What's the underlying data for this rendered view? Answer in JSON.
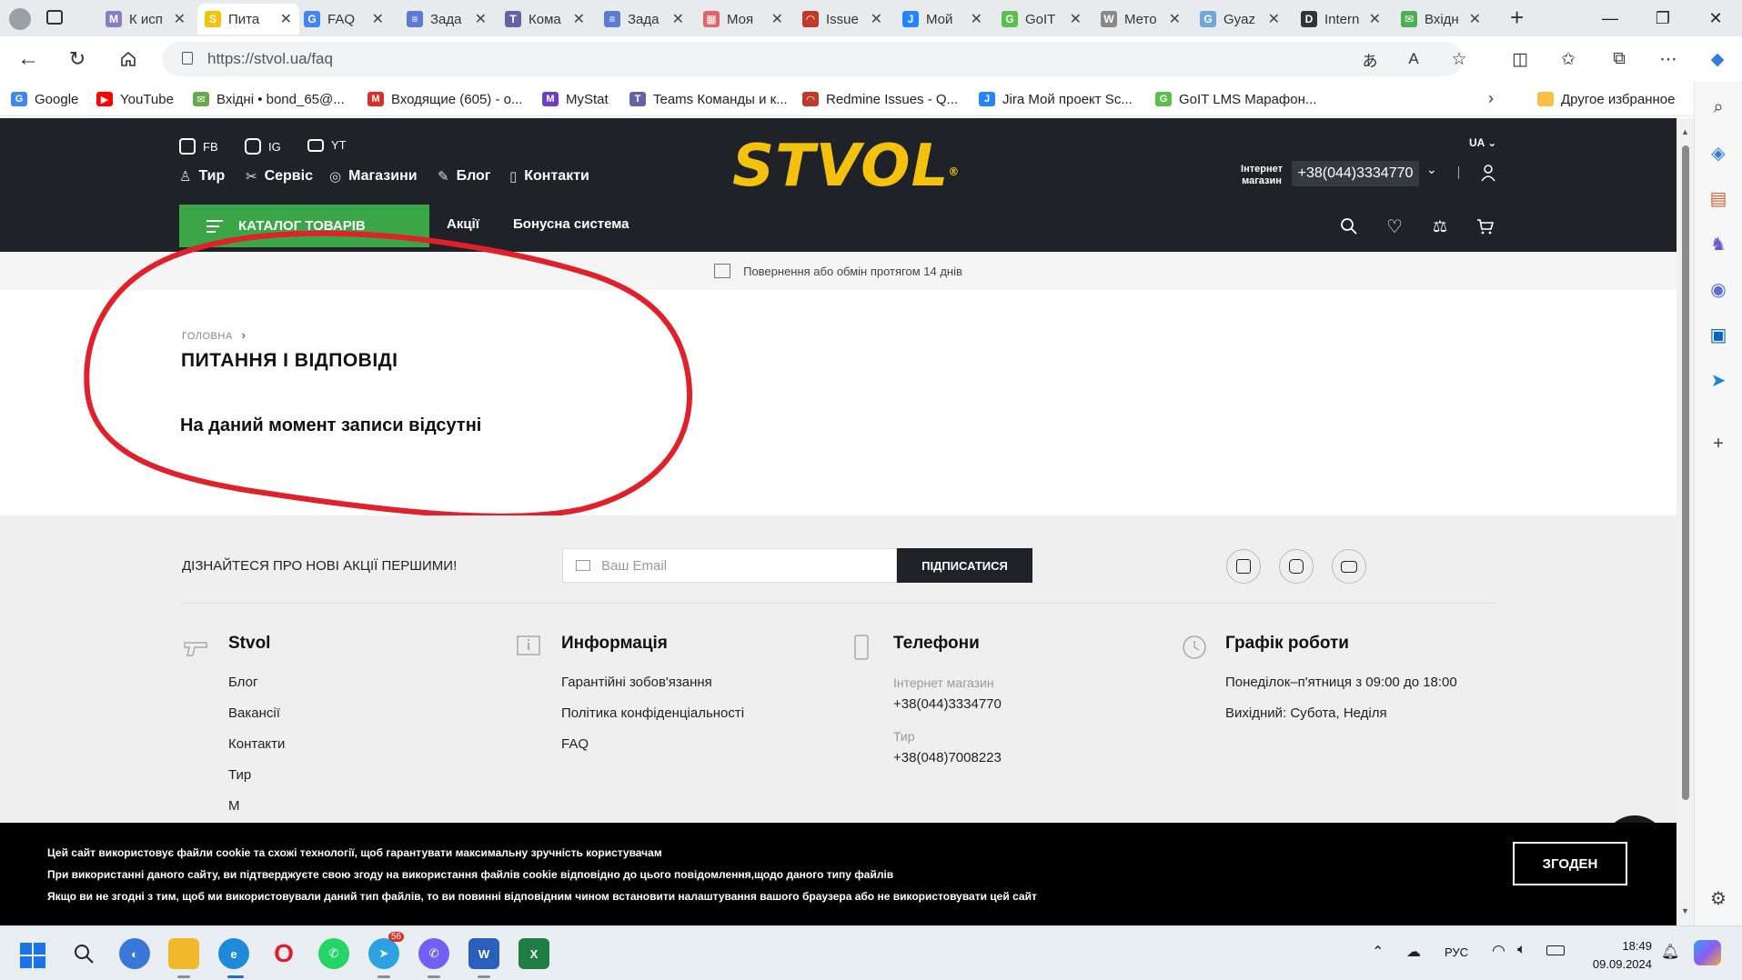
{
  "browser": {
    "tabs": [
      {
        "title": "К исп",
        "color": "#8e7cc3",
        "glyph": "M"
      },
      {
        "title": "Пита",
        "color": "#f4c20d",
        "glyph": "S"
      },
      {
        "title": "FAQ",
        "color": "#4285f4",
        "glyph": "G"
      },
      {
        "title": "Зада",
        "color": "#5b7bd5",
        "glyph": "≡"
      },
      {
        "title": "Кома",
        "color": "#6264a7",
        "glyph": "T"
      },
      {
        "title": "Зада",
        "color": "#5b7bd5",
        "glyph": "≡"
      },
      {
        "title": "Моя",
        "color": "#e06666",
        "glyph": "▦"
      },
      {
        "title": "Issue",
        "color": "#c0392b",
        "glyph": "◠"
      },
      {
        "title": "Мой",
        "color": "#2684ff",
        "glyph": "J"
      },
      {
        "title": "GoIT",
        "color": "#5bbf4a",
        "glyph": "G"
      },
      {
        "title": "Мето",
        "color": "#888888",
        "glyph": "W"
      },
      {
        "title": "Gyaz",
        "color": "#6fa8dc",
        "glyph": "G"
      },
      {
        "title": "Intern",
        "color": "#333333",
        "glyph": "D"
      },
      {
        "title": "Вхідн",
        "color": "#4caf50",
        "glyph": "✉"
      }
    ],
    "url": "https://stvol.ua/faq",
    "favorites": [
      {
        "label": "Google",
        "color": "#4285f4",
        "glyph": "G"
      },
      {
        "label": "YouTube",
        "color": "#ff0000",
        "glyph": "▶"
      },
      {
        "label": "Вхідні • bond_65@...",
        "color": "#6aa84f",
        "glyph": "✉"
      },
      {
        "label": "Входящие (605) - о...",
        "color": "#d93025",
        "glyph": "M"
      },
      {
        "label": "MyStat",
        "color": "#6a3fc7",
        "glyph": "M"
      },
      {
        "label": "Teams Команды и к...",
        "color": "#6264a7",
        "glyph": "T"
      },
      {
        "label": "Redmine Issues - Q...",
        "color": "#c0392b",
        "glyph": "◠"
      },
      {
        "label": "Jira Мой проект Sc...",
        "color": "#2684ff",
        "glyph": "J"
      },
      {
        "label": "GoIT LMS Марафон...",
        "color": "#5bbf4a",
        "glyph": "G"
      }
    ],
    "other_favorites": "Другое избранное"
  },
  "site": {
    "social_top": [
      "FB",
      "IG",
      "YT"
    ],
    "nav": [
      {
        "label": "Тир",
        "icon": "target-icon"
      },
      {
        "label": "Сервіс",
        "icon": "wrench-icon"
      },
      {
        "label": "Магазини",
        "icon": "pin-icon"
      },
      {
        "label": "Блог",
        "icon": "pen-icon"
      },
      {
        "label": "Контакти",
        "icon": "phone-icon"
      }
    ],
    "logo": "STVOL",
    "logo_mark": "®",
    "lang": "UA",
    "shop_label_1": "Інтернет",
    "shop_label_2": "магазин",
    "phone": "+38(044)3334770",
    "catalog_button": "КАТАЛОГ ТОВАРІВ",
    "subnav": [
      "Акції",
      "Бонусна система"
    ],
    "promo": "Повернення або обмін протягом 14 днів",
    "breadcrumb_home": "ГОЛОВНА",
    "breadcrumb_sep": "›",
    "page_title": "ПИТАННЯ І ВІДПОВІДІ",
    "empty_message": "На даний момент записи відсутні"
  },
  "footer": {
    "subscribe_text": "ДІЗНАЙТЕСЯ ПРО НОВІ АКЦІЇ ПЕРШИМИ!",
    "email_placeholder": "Ваш Email",
    "subscribe_button": "ПІДПИСАТИСЯ",
    "col1": {
      "title": "Stvol",
      "links": [
        "Блог",
        "Вакансії",
        "Контакти",
        "Тир",
        "М"
      ]
    },
    "col2": {
      "title": "Информація",
      "links": [
        "Гарантійні зобов'язання",
        "Політика конфіденціальності",
        "FAQ"
      ]
    },
    "col3": {
      "title": "Телефони",
      "label1": "Інтернет магазин",
      "phone1": "+38(044)3334770",
      "label2": "Тир",
      "phone2": "+38(048)7008223"
    },
    "col4": {
      "title": "Графік роботи",
      "line1": "Понеділок–п'ятниця з 09:00 до 18:00",
      "line2": "Вихідний: Субота, Неділя"
    }
  },
  "cookie": {
    "line1": "Цей сайт використовує файли cookie та схожі технології, щоб гарантувати максимальну зручність користувачам",
    "line2": "При використанні даного сайту, ви підтверджуєте свою згоду на використання файлів cookie відповідно до цього повідомлення,щодо даного типу файлів",
    "line3": "Якщо ви не згодні з тим, щоб ми використовували даний тип файлів, то ви повинні відповідним чином встановити налаштування вашого браузера або не використовувати цей сайт",
    "agree_button": "ЗГОДЕН"
  },
  "taskbar": {
    "lang": "РУС",
    "time": "18:49",
    "date": "09.09.2024",
    "telegram_badge": "56"
  },
  "colors": {
    "accent_yellow": "#f4c20d",
    "green": "#3aa647",
    "header_dark": "#1f2327",
    "annotation_red": "#e0202a"
  }
}
